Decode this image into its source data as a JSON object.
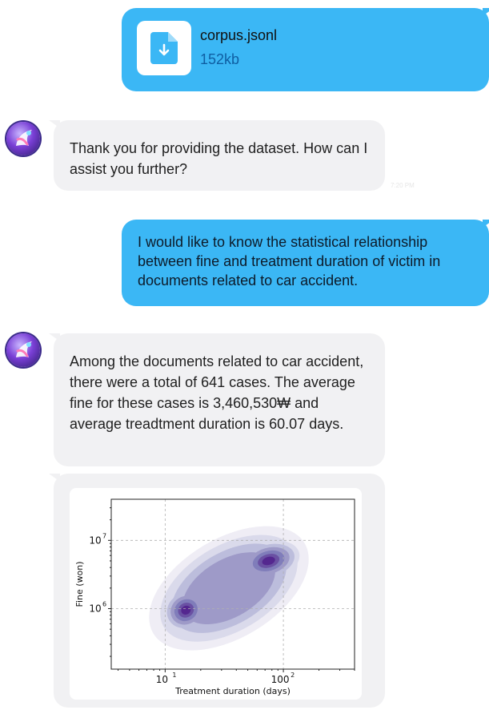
{
  "messages": {
    "file": {
      "name": "corpus.jsonl",
      "size": "152kb",
      "icon": "file-download-icon"
    },
    "bot_reply_1": {
      "text": "Thank you for providing the dataset. How can I assist you further?",
      "time": "7:20 PM"
    },
    "user_question": {
      "text": "I would like to know the statistical relationship between fine and treatment duration of victim in documents related to car accident."
    },
    "bot_reply_2": {
      "text": "Among the documents related to car accident, there were a total of 641 cases. The average fine for these cases is 3,460,530₩ and average treadtment duration is 60.07 days."
    }
  },
  "colors": {
    "user_bubble": "#3bb7f5",
    "bot_bubble": "#f1f1f3",
    "density": "#5b2c9e"
  },
  "chart_data": {
    "type": "heatmap",
    "kind": "2D kernel density estimate",
    "xlabel": "Treatment duration (days)",
    "ylabel": "Fine (won)",
    "xscale": "log",
    "yscale": "log",
    "xlim": [
      3.5,
      400
    ],
    "ylim": [
      130000,
      40000000
    ],
    "xticks": [
      10,
      100
    ],
    "xtick_labels": [
      "10",
      "100"
    ],
    "yticks": [
      1000000,
      10000000
    ],
    "ytick_labels": [
      "10",
      "10"
    ],
    "tick_exponents": {
      "x": [
        "1",
        "2"
      ],
      "y": [
        "6",
        "7"
      ]
    },
    "grid": "dashed",
    "density_peaks": [
      {
        "x": 15,
        "y": 950000
      },
      {
        "x": 75,
        "y": 5000000
      }
    ]
  }
}
